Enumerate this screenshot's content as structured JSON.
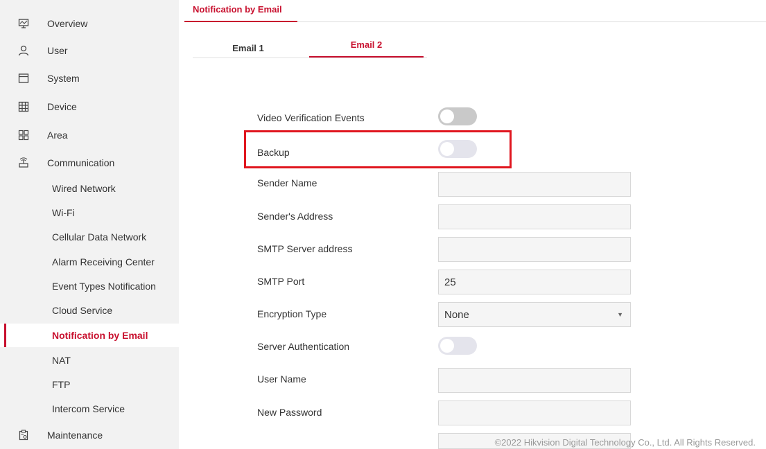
{
  "sidebar": {
    "items": [
      {
        "label": "Overview",
        "icon": "monitor-icon"
      },
      {
        "label": "User",
        "icon": "user-icon"
      },
      {
        "label": "System",
        "icon": "system-window-icon"
      },
      {
        "label": "Device",
        "icon": "device-grid-icon"
      },
      {
        "label": "Area",
        "icon": "area-grid-icon"
      },
      {
        "label": "Communication",
        "icon": "communication-antenna-icon"
      }
    ],
    "subitems": [
      {
        "label": "Wired Network"
      },
      {
        "label": "Wi-Fi"
      },
      {
        "label": "Cellular Data Network"
      },
      {
        "label": "Alarm Receiving Center"
      },
      {
        "label": "Event Types Notification"
      },
      {
        "label": "Cloud Service"
      },
      {
        "label": "Notification by Email"
      },
      {
        "label": "NAT"
      },
      {
        "label": "FTP"
      },
      {
        "label": "Intercom Service"
      }
    ],
    "maintenance": {
      "label": "Maintenance",
      "icon": "maintenance-clipboard-icon"
    },
    "active_subitem": "Notification by Email"
  },
  "header": {
    "page_tab": "Notification by Email"
  },
  "tabs": {
    "email1": "Email 1",
    "email2": "Email 2",
    "active": "Email 2"
  },
  "form": {
    "video_verification": {
      "label": "Video Verification Events",
      "enabled": false
    },
    "backup": {
      "label": "Backup",
      "enabled": false
    },
    "sender_name": {
      "label": "Sender Name",
      "value": ""
    },
    "sender_address": {
      "label": "Sender's Address",
      "value": ""
    },
    "smtp_server": {
      "label": "SMTP Server address",
      "value": ""
    },
    "smtp_port": {
      "label": "SMTP Port",
      "value": "25"
    },
    "encryption": {
      "label": "Encryption Type",
      "value": "None"
    },
    "server_auth": {
      "label": "Server Authentication",
      "enabled": false
    },
    "user_name": {
      "label": "User Name",
      "value": ""
    },
    "new_password": {
      "label": "New Password",
      "value": ""
    }
  },
  "footer": {
    "copyright": "©2022 Hikvision Digital Technology Co., Ltd. All Rights Reserved."
  },
  "colors": {
    "accent": "#c8102e",
    "highlight": "#e0161f"
  }
}
